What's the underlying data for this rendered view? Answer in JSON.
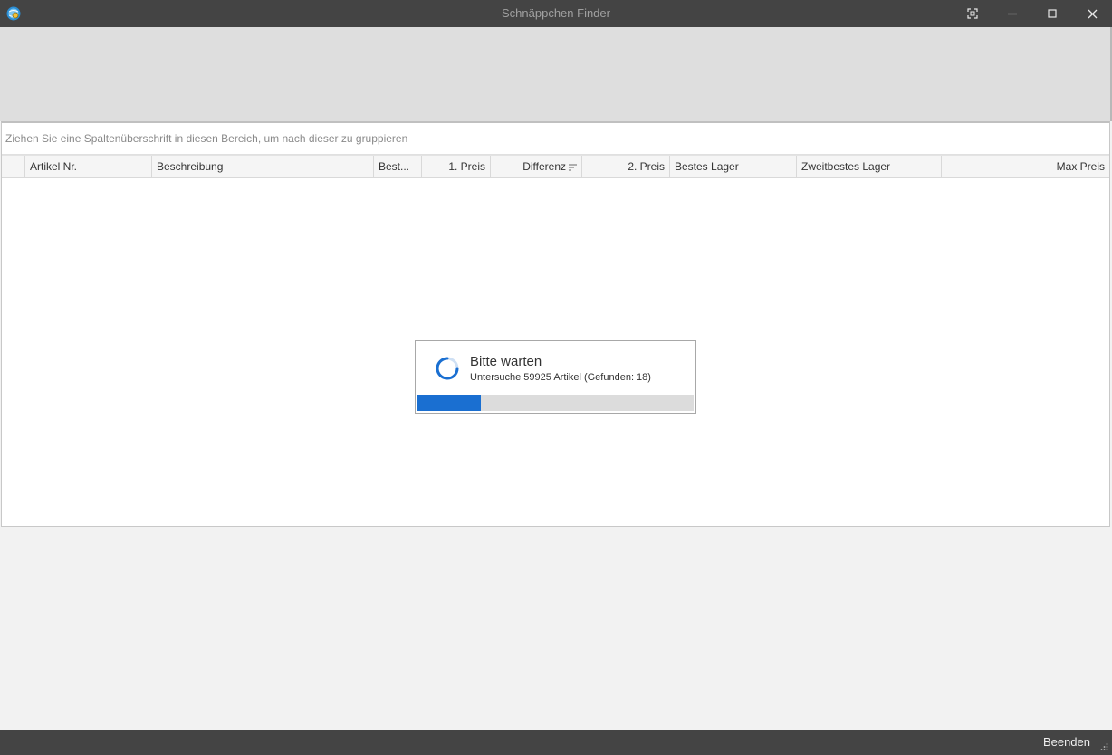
{
  "window": {
    "title": "Schnäppchen Finder"
  },
  "grid": {
    "group_panel_hint": "Ziehen Sie eine Spaltenüberschrift in diesen Bereich, um nach dieser zu gruppieren",
    "columns": [
      {
        "label": "Artikel Nr."
      },
      {
        "label": "Beschreibung"
      },
      {
        "label": "Best..."
      },
      {
        "label": "1. Preis"
      },
      {
        "label": "Differenz"
      },
      {
        "label": "2. Preis"
      },
      {
        "label": "Bestes Lager"
      },
      {
        "label": "Zweitbestes Lager"
      },
      {
        "label": "Max Preis"
      }
    ]
  },
  "wait_dialog": {
    "title": "Bitte warten",
    "message": "Untersuche 59925 Artikel (Gefunden: 18)",
    "progress_percent": 23
  },
  "statusbar": {
    "close_label": "Beenden"
  },
  "colors": {
    "titlebar_bg": "#444444",
    "accent": "#1a6fd1"
  },
  "icons": {
    "app": "globe-search-icon",
    "sort": "sort-descending-icon",
    "spinner": "loading-spinner-icon"
  }
}
